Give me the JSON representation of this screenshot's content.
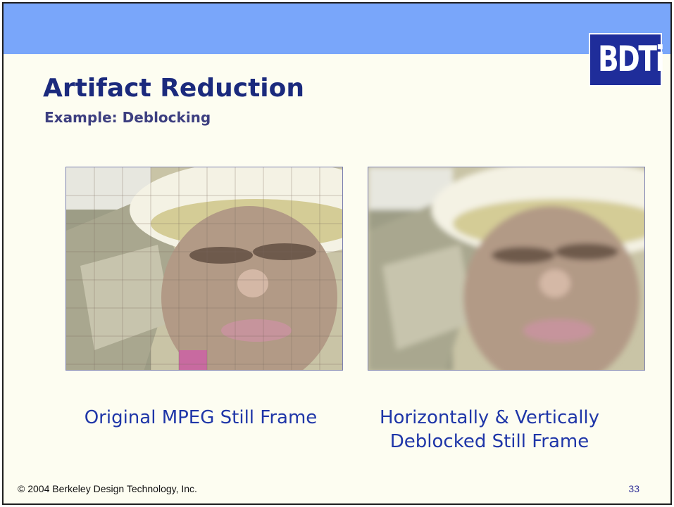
{
  "slide": {
    "logo_text": "BDTi",
    "title": "Artifact Reduction",
    "subtitle": "Example: Deblocking",
    "images": [
      {
        "caption": "Original MPEG Still Frame"
      },
      {
        "caption_line1": "Horizontally & Vertically",
        "caption_line2": "Deblocked Still Frame"
      }
    ],
    "footer": "© 2004 Berkeley Design Technology, Inc.",
    "page_number": "33"
  },
  "colors": {
    "header_bar": "#79a6fa",
    "background": "#fdfdf1",
    "title": "#1b2a7d",
    "caption": "#1f36a8",
    "logo_bg": "#1f2d9a"
  }
}
